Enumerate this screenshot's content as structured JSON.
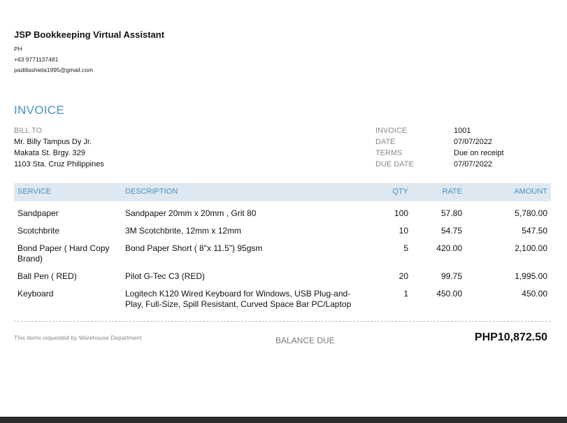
{
  "company": {
    "name": "JSP Bookkeeping Virtual Assistant",
    "country": "PH",
    "phone": "+63 9771137481",
    "email": "padillashiela1995@gmail.com"
  },
  "invoice_title": "INVOICE",
  "bill_to": {
    "label": "BILL TO",
    "name": "Mr. Billy Tampus Dy Jr.",
    "address1": "Makata St. Brgy. 329",
    "address2": "1103 Sta. Cruz Philippines"
  },
  "meta": [
    {
      "label": "INVOICE",
      "value": "1001"
    },
    {
      "label": "DATE",
      "value": "07/07/2022"
    },
    {
      "label": "TERMS",
      "value": "Due on receipt"
    },
    {
      "label": "DUE DATE",
      "value": "07/07/2022"
    }
  ],
  "table": {
    "headers": {
      "service": "SERVICE",
      "description": "DESCRIPTION",
      "qty": "QTY",
      "rate": "RATE",
      "amount": "AMOUNT"
    },
    "rows": [
      {
        "service": "Sandpaper",
        "description": "Sandpaper 20mm x 20mm , Grit 80",
        "qty": "100",
        "rate": "57.80",
        "amount": "5,780.00"
      },
      {
        "service": "Scotchbrite",
        "description": "3M Scotchbrite, 12mm x 12mm",
        "qty": "10",
        "rate": "54.75",
        "amount": "547.50"
      },
      {
        "service": "Bond Paper ( Hard Copy Brand)",
        "description": "Bond Paper Short ( 8\"x 11.5\") 95gsm",
        "qty": "5",
        "rate": "420.00",
        "amount": "2,100.00"
      },
      {
        "service": "Ball Pen ( RED)",
        "description": "Pilot G-Tec C3 (RED)",
        "qty": "20",
        "rate": "99.75",
        "amount": "1,995.00"
      },
      {
        "service": "Keyboard",
        "description": "Logitech K120 Wired Keyboard for Windows, USB Plug-and-Play, Full-Size, Spill Resistant, Curved Space Bar PC/Laptop",
        "qty": "1",
        "rate": "450.00",
        "amount": "450.00"
      }
    ]
  },
  "footer": {
    "note": "This items requested by Warehouse Department",
    "balance_label": "BALANCE DUE",
    "balance_value": "PHP10,872.50"
  }
}
